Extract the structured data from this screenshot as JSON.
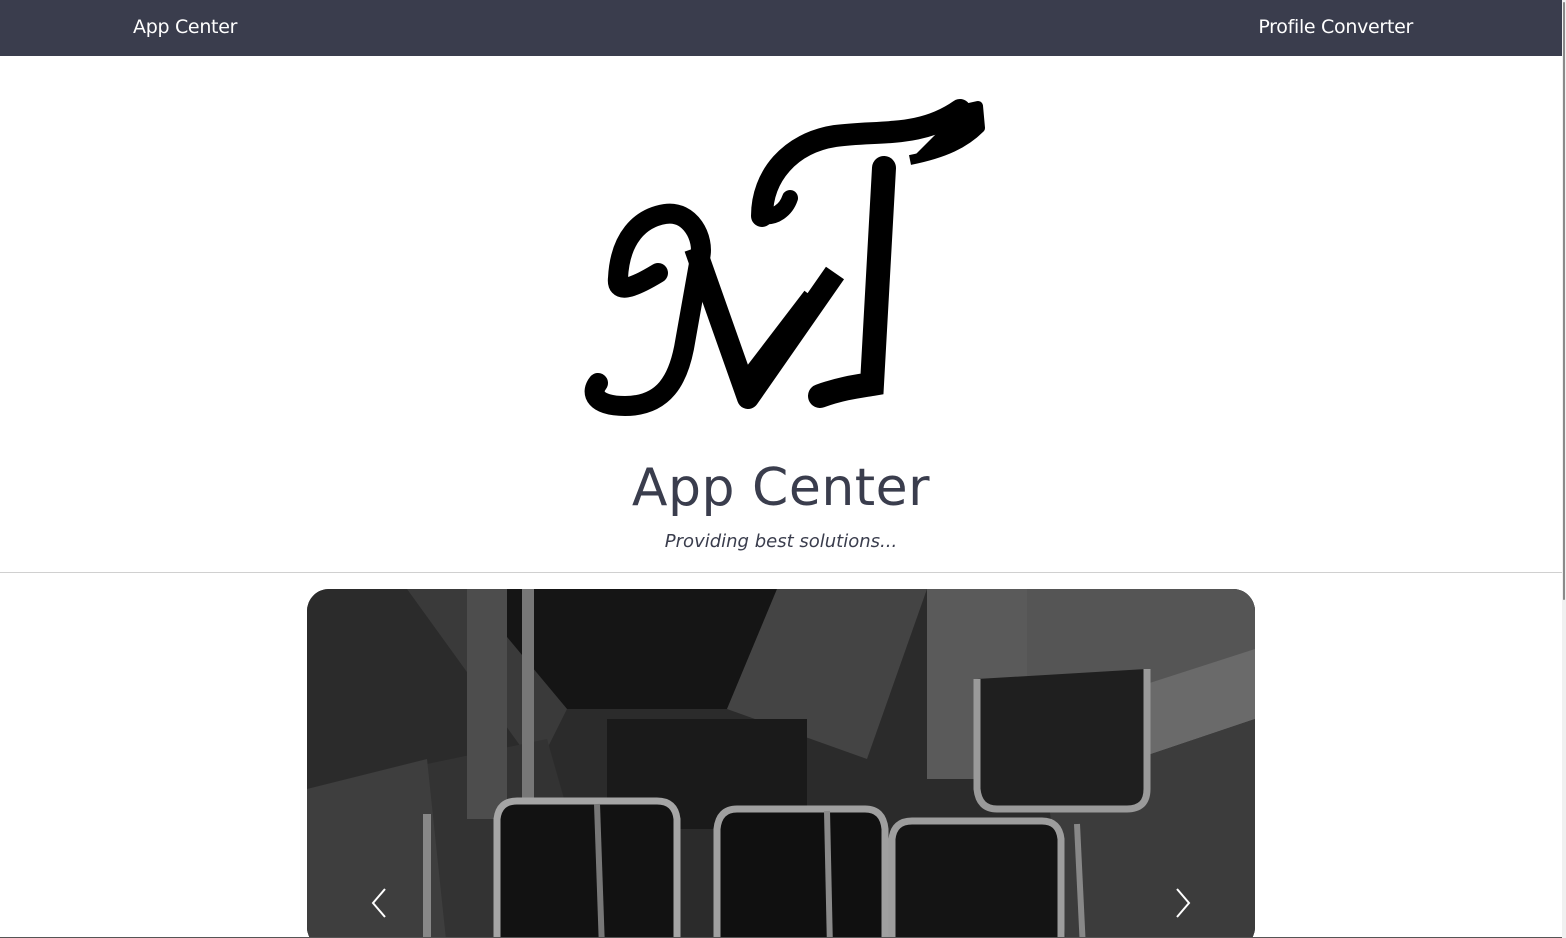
{
  "nav": {
    "brand": "App Center",
    "link": "Profile Converter"
  },
  "hero": {
    "logo_icon": "mt-monogram-logo",
    "title": "App Center",
    "subtitle": "Providing best solutions..."
  },
  "carousel": {
    "image_icon": "steel-profiles-photo",
    "prev_icon": "chevron-left-icon",
    "next_icon": "chevron-right-icon"
  },
  "colors": {
    "navbar": "#3a3d4d",
    "title": "#3a3d4d",
    "divider": "#d0d0d0"
  }
}
